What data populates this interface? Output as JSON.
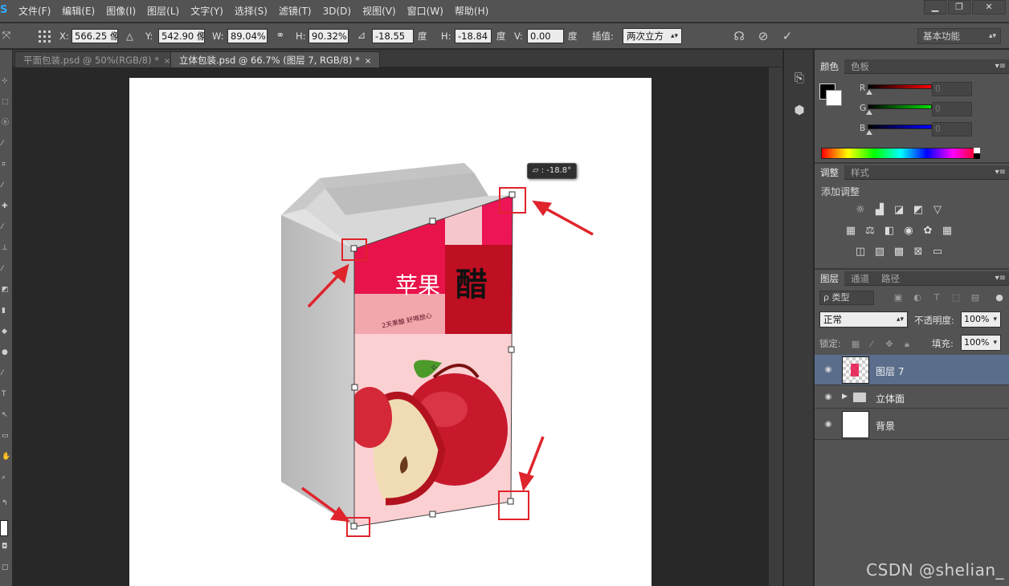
{
  "menu": {
    "logo": "S",
    "items": [
      "文件(F)",
      "编辑(E)",
      "图像(I)",
      "图层(L)",
      "文字(Y)",
      "选择(S)",
      "滤镜(T)",
      "3D(D)",
      "视图(V)",
      "窗口(W)",
      "帮助(H)"
    ]
  },
  "window_controls": {
    "minimize": "▁",
    "restore": "❐",
    "close": "✕"
  },
  "options": {
    "x_label": "X:",
    "x_value": "566.25 像",
    "delta_icon": "△",
    "y_label": "Y:",
    "y_value": "542.90 像",
    "w_label": "W:",
    "w_value": "89.04%",
    "h_label": "H:",
    "h_value": "90.32%",
    "angle_value": "-18.55",
    "angle_unit": "度",
    "hskew_label": "H:",
    "hskew_value": "-18.84",
    "hskew_unit": "度",
    "vskew_label": "V:",
    "vskew_value": "0.00",
    "vskew_unit": "度",
    "interp_label": "插值:",
    "interp_value": "两次立方",
    "workspace": "基本功能"
  },
  "tabs": [
    {
      "label": "平面包装.psd @ 50%(RGB/8) *",
      "close": "×"
    },
    {
      "label": "立体包装.psd @ 66.7% (图层 7, RGB/8) *",
      "close": "×"
    }
  ],
  "canvas": {
    "tooltip": "⏥ : -18.8°",
    "package": {
      "title": "苹果",
      "logo": "醋",
      "slogan": "2天果酿  好喝放心"
    }
  },
  "watermark": "CSDN @shelian_",
  "color_panel": {
    "tabs": [
      "颜色",
      "色板"
    ],
    "r_label": "R",
    "g_label": "G",
    "b_label": "B",
    "r_value": "0",
    "g_value": "0",
    "b_value": "0"
  },
  "adjustments_panel": {
    "tabs": [
      "调整",
      "样式"
    ],
    "title": "添加调整"
  },
  "layers_panel": {
    "tabs": [
      "图层",
      "通道",
      "路径"
    ],
    "filter": "ρ 类型",
    "blend_mode": "正常",
    "opacity_label": "不透明度:",
    "opacity_value": "100%",
    "lock_label": "锁定:",
    "fill_label": "填充:",
    "fill_value": "100%",
    "layers": [
      {
        "name": "图层 7",
        "selected": true
      },
      {
        "name": "立体面",
        "selected": false
      },
      {
        "name": "背景",
        "selected": false
      }
    ]
  }
}
